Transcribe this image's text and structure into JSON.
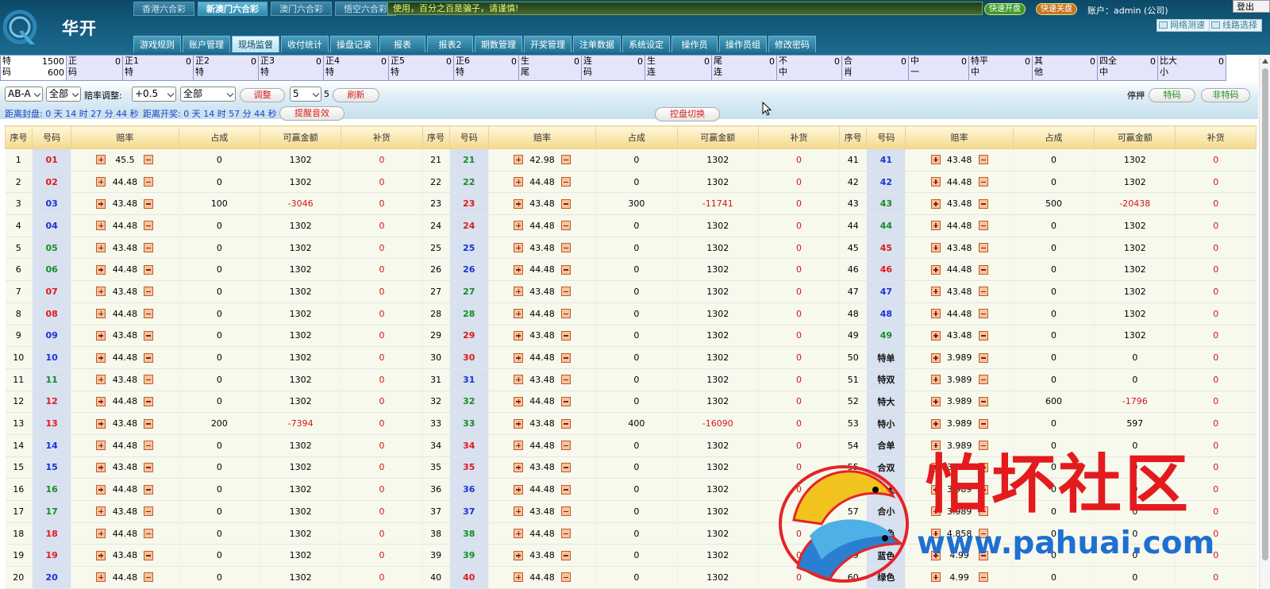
{
  "header": {
    "brand": "华开",
    "lottery_tabs": [
      "香港六合彩",
      "新澳门六合彩",
      "澳门六合彩",
      "悟空六合彩"
    ],
    "active_lottery": 1,
    "notice": "使用，百分之百是骗子，请谨慎!",
    "quick_open": "快速开盘",
    "quick_close": "快速关盘",
    "account": "账户：admin (公司)",
    "logout": "登出",
    "net_test": "网络测速",
    "line_select": "线路选择"
  },
  "menu": [
    "游戏规则",
    "账户管理",
    "现场监督",
    "收付统计",
    "操盘记录",
    "报表",
    "报表2",
    "期数管理",
    "开奖管理",
    "注单数据",
    "系统设定",
    "操作员",
    "操作员组",
    "修改密码"
  ],
  "active_menu": 2,
  "summary": [
    {
      "label": "特\n码",
      "value": "1500\n600"
    },
    {
      "label": "正\n码",
      "value": "0"
    },
    {
      "label": "正1\n特",
      "value": "0"
    },
    {
      "label": "正2\n特",
      "value": "0"
    },
    {
      "label": "正3\n特",
      "value": "0"
    },
    {
      "label": "正4\n特",
      "value": "0"
    },
    {
      "label": "正5\n特",
      "value": "0"
    },
    {
      "label": "正6\n特",
      "value": "0"
    },
    {
      "label": "生\n尾",
      "value": "0"
    },
    {
      "label": "连\n码",
      "value": "0"
    },
    {
      "label": "生\n连",
      "value": "0"
    },
    {
      "label": "尾\n连",
      "value": "0"
    },
    {
      "label": "不\n中",
      "value": "0"
    },
    {
      "label": "合\n肖",
      "value": "0"
    },
    {
      "label": "中\n一",
      "value": "0"
    },
    {
      "label": "特平\n中",
      "value": "0"
    },
    {
      "label": "其\n他",
      "value": "0"
    },
    {
      "label": "四全\n中",
      "value": "0"
    },
    {
      "label": "比大\n小",
      "value": "0"
    }
  ],
  "controls": {
    "plate": "AB-A",
    "scope": "全部",
    "odds_adjust_label": "赔率调整:",
    "odds_step": "+0.5",
    "odds_scope": "全部",
    "adjust_btn": "调整",
    "interval": "5",
    "interval_suffix": "5",
    "refresh_btn": "刷新",
    "close_countdown": "距离封盘: 0 天 14 时 27 分 44 秒",
    "draw_countdown": "距离开奖: 0 天 14 时 57 分 44 秒",
    "sound_btn": "提醒音效",
    "switch_btn": "控盘切换",
    "stop_label": "停押",
    "special_btn": "特码",
    "nonspecial_btn": "非特码"
  },
  "table": {
    "headers": [
      "序号",
      "号码",
      "赔率",
      "占成",
      "可赢金额",
      "补货"
    ],
    "rows": [
      [
        [
          "1",
          "01",
          "red",
          "45.5",
          "0",
          "1302",
          "0"
        ],
        [
          "21",
          "21",
          "green",
          "42.98",
          "0",
          "1302",
          "0"
        ],
        [
          "41",
          "41",
          "blue",
          "43.48",
          "0",
          "1302",
          "0"
        ]
      ],
      [
        [
          "2",
          "02",
          "red",
          "44.48",
          "0",
          "1302",
          "0"
        ],
        [
          "22",
          "22",
          "green",
          "44.48",
          "0",
          "1302",
          "0"
        ],
        [
          "42",
          "42",
          "blue",
          "44.48",
          "0",
          "1302",
          "0"
        ]
      ],
      [
        [
          "3",
          "03",
          "blue",
          "43.48",
          "100",
          "-3046",
          "0"
        ],
        [
          "23",
          "23",
          "red",
          "43.48",
          "300",
          "-11741",
          "0"
        ],
        [
          "43",
          "43",
          "green",
          "43.48",
          "500",
          "-20438",
          "0"
        ]
      ],
      [
        [
          "4",
          "04",
          "blue",
          "44.48",
          "0",
          "1302",
          "0"
        ],
        [
          "24",
          "24",
          "red",
          "44.48",
          "0",
          "1302",
          "0"
        ],
        [
          "44",
          "44",
          "green",
          "44.48",
          "0",
          "1302",
          "0"
        ]
      ],
      [
        [
          "5",
          "05",
          "green",
          "43.48",
          "0",
          "1302",
          "0"
        ],
        [
          "25",
          "25",
          "blue",
          "43.48",
          "0",
          "1302",
          "0"
        ],
        [
          "45",
          "45",
          "red",
          "43.48",
          "0",
          "1302",
          "0"
        ]
      ],
      [
        [
          "6",
          "06",
          "green",
          "44.48",
          "0",
          "1302",
          "0"
        ],
        [
          "26",
          "26",
          "blue",
          "44.48",
          "0",
          "1302",
          "0"
        ],
        [
          "46",
          "46",
          "red",
          "44.48",
          "0",
          "1302",
          "0"
        ]
      ],
      [
        [
          "7",
          "07",
          "red",
          "43.48",
          "0",
          "1302",
          "0"
        ],
        [
          "27",
          "27",
          "green",
          "43.48",
          "0",
          "1302",
          "0"
        ],
        [
          "47",
          "47",
          "blue",
          "43.48",
          "0",
          "1302",
          "0"
        ]
      ],
      [
        [
          "8",
          "08",
          "red",
          "44.48",
          "0",
          "1302",
          "0"
        ],
        [
          "28",
          "28",
          "green",
          "44.48",
          "0",
          "1302",
          "0"
        ],
        [
          "48",
          "48",
          "blue",
          "44.48",
          "0",
          "1302",
          "0"
        ]
      ],
      [
        [
          "9",
          "09",
          "blue",
          "43.48",
          "0",
          "1302",
          "0"
        ],
        [
          "29",
          "29",
          "red",
          "43.48",
          "0",
          "1302",
          "0"
        ],
        [
          "49",
          "49",
          "green",
          "43.48",
          "0",
          "1302",
          "0"
        ]
      ],
      [
        [
          "10",
          "10",
          "blue",
          "44.48",
          "0",
          "1302",
          "0"
        ],
        [
          "30",
          "30",
          "red",
          "44.48",
          "0",
          "1302",
          "0"
        ],
        [
          "50",
          "特单",
          "black",
          "3.989",
          "0",
          "0",
          "0"
        ]
      ],
      [
        [
          "11",
          "11",
          "green",
          "43.48",
          "0",
          "1302",
          "0"
        ],
        [
          "31",
          "31",
          "blue",
          "43.48",
          "0",
          "1302",
          "0"
        ],
        [
          "51",
          "特双",
          "black",
          "3.989",
          "0",
          "0",
          "0"
        ]
      ],
      [
        [
          "12",
          "12",
          "red",
          "44.48",
          "0",
          "1302",
          "0"
        ],
        [
          "32",
          "32",
          "green",
          "44.48",
          "0",
          "1302",
          "0"
        ],
        [
          "52",
          "特大",
          "black",
          "3.989",
          "600",
          "-1796",
          "0"
        ]
      ],
      [
        [
          "13",
          "13",
          "red",
          "43.48",
          "200",
          "-7394",
          "0"
        ],
        [
          "33",
          "33",
          "green",
          "43.48",
          "400",
          "-16090",
          "0"
        ],
        [
          "53",
          "特小",
          "black",
          "3.989",
          "0",
          "597",
          "0"
        ]
      ],
      [
        [
          "14",
          "14",
          "blue",
          "44.48",
          "0",
          "1302",
          "0"
        ],
        [
          "34",
          "34",
          "red",
          "44.48",
          "0",
          "1302",
          "0"
        ],
        [
          "54",
          "合单",
          "black",
          "3.989",
          "0",
          "0",
          "0"
        ]
      ],
      [
        [
          "15",
          "15",
          "blue",
          "43.48",
          "0",
          "1302",
          "0"
        ],
        [
          "35",
          "35",
          "red",
          "43.48",
          "0",
          "1302",
          "0"
        ],
        [
          "55",
          "合双",
          "black",
          "3.989",
          "0",
          "0",
          "0"
        ]
      ],
      [
        [
          "16",
          "16",
          "green",
          "44.48",
          "0",
          "1302",
          "0"
        ],
        [
          "36",
          "36",
          "blue",
          "44.48",
          "0",
          "1302",
          "0"
        ],
        [
          "56",
          "合大",
          "black",
          "3.989",
          "0",
          "0",
          "0"
        ]
      ],
      [
        [
          "17",
          "17",
          "green",
          "43.48",
          "0",
          "1302",
          "0"
        ],
        [
          "37",
          "37",
          "blue",
          "43.48",
          "0",
          "1302",
          "0"
        ],
        [
          "57",
          "合小",
          "black",
          "3.989",
          "0",
          "0",
          "0"
        ]
      ],
      [
        [
          "18",
          "18",
          "red",
          "44.48",
          "0",
          "1302",
          "0"
        ],
        [
          "38",
          "38",
          "green",
          "44.48",
          "0",
          "1302",
          "0"
        ],
        [
          "58",
          "红色",
          "black",
          "4.858",
          "0",
          "0",
          "0"
        ]
      ],
      [
        [
          "19",
          "19",
          "red",
          "43.48",
          "0",
          "1302",
          "0"
        ],
        [
          "39",
          "39",
          "green",
          "43.48",
          "0",
          "1302",
          "0"
        ],
        [
          "59",
          "蓝色",
          "black",
          "4.99",
          "0",
          "0",
          "0"
        ]
      ],
      [
        [
          "20",
          "20",
          "blue",
          "44.48",
          "0",
          "1302",
          "0"
        ],
        [
          "40",
          "40",
          "red",
          "44.48",
          "0",
          "1302",
          "0"
        ],
        [
          "60",
          "绿色",
          "black",
          "4.99",
          "0",
          "0",
          "0"
        ]
      ]
    ]
  },
  "watermark": {
    "text": "怕坏社区",
    "url": "www.pahuai.com"
  },
  "colors": {
    "red": "#e0191c",
    "blue": "#1a31d6",
    "green": "#178a23",
    "header": "#145a7c"
  }
}
